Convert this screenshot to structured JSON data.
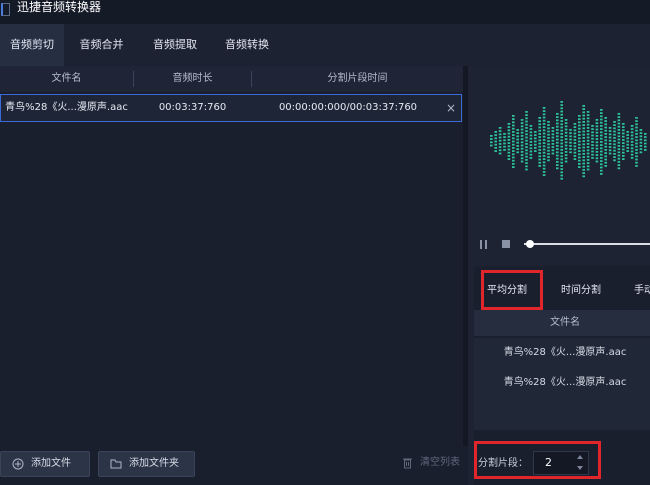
{
  "app": {
    "title": "迅捷音频转换器"
  },
  "tabs": [
    {
      "label": "音频剪切",
      "active": true
    },
    {
      "label": "音频合并",
      "active": false
    },
    {
      "label": "音频提取",
      "active": false
    },
    {
      "label": "音频转换",
      "active": false
    }
  ],
  "file_table": {
    "columns": [
      "文件名",
      "音频时长",
      "分割片段时间"
    ],
    "rows": [
      {
        "file_name": "青鸟%28《火...漫原声.aac",
        "duration": "00:03:37:760",
        "split_time": "00:00:00:000/00:03:37:760",
        "close_symbol": "×"
      }
    ]
  },
  "bottom_toolbar": {
    "add_file": "添加文件",
    "add_folder": "添加文件夹",
    "clear_list": "清空列表"
  },
  "split": {
    "tabs": [
      "平均分割",
      "时间分割",
      "手动分割"
    ],
    "selected_tab": "平均分割",
    "table_header": "文件名",
    "items": [
      "青鸟%28《火...漫原声.aac",
      "青鸟%28《火...漫原声.aac"
    ],
    "segment_label": "分割片段：",
    "segment_value": "2"
  },
  "colors": {
    "waveform": "#2ec29a",
    "highlight": "#e0262b",
    "selection": "#3c6bd9"
  },
  "icons": {
    "add_file": "plus-circle-icon",
    "add_folder": "folder-icon",
    "clear_list": "trash-icon",
    "pause": "pause-icon",
    "stop": "stop-icon",
    "row_close": "close-icon"
  }
}
